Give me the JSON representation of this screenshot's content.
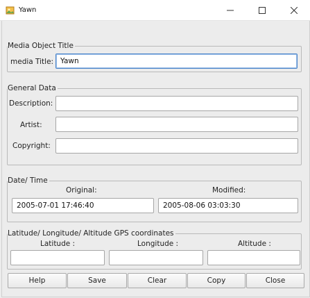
{
  "window": {
    "title": "Yawn",
    "controls": {
      "minimize": "−",
      "maximize": "□",
      "close": "✕"
    }
  },
  "media_title": {
    "legend": "Media Object Title",
    "label": "media Title:",
    "value": "Yawn"
  },
  "general": {
    "legend": "General Data",
    "description_label": "Description:",
    "description_value": "",
    "artist_label": "Artist:",
    "artist_value": "",
    "copyright_label": "Copyright:",
    "copyright_value": ""
  },
  "datetime": {
    "legend": "Date/ Time",
    "original_label": "Original:",
    "original_value": "2005-07-01 17:46:40",
    "modified_label": "Modified:",
    "modified_value": "2005-08-06 03:03:30"
  },
  "gps": {
    "legend": "Latitude/ Longitude/ Altitude GPS coordinates",
    "latitude_label": "Latitude :",
    "latitude_value": "",
    "longitude_label": "Longitude :",
    "longitude_value": "",
    "altitude_label": "Altitude :",
    "altitude_value": ""
  },
  "buttons": {
    "help": "Help",
    "save": "Save",
    "clear": "Clear",
    "copy": "Copy",
    "close": "Close"
  }
}
